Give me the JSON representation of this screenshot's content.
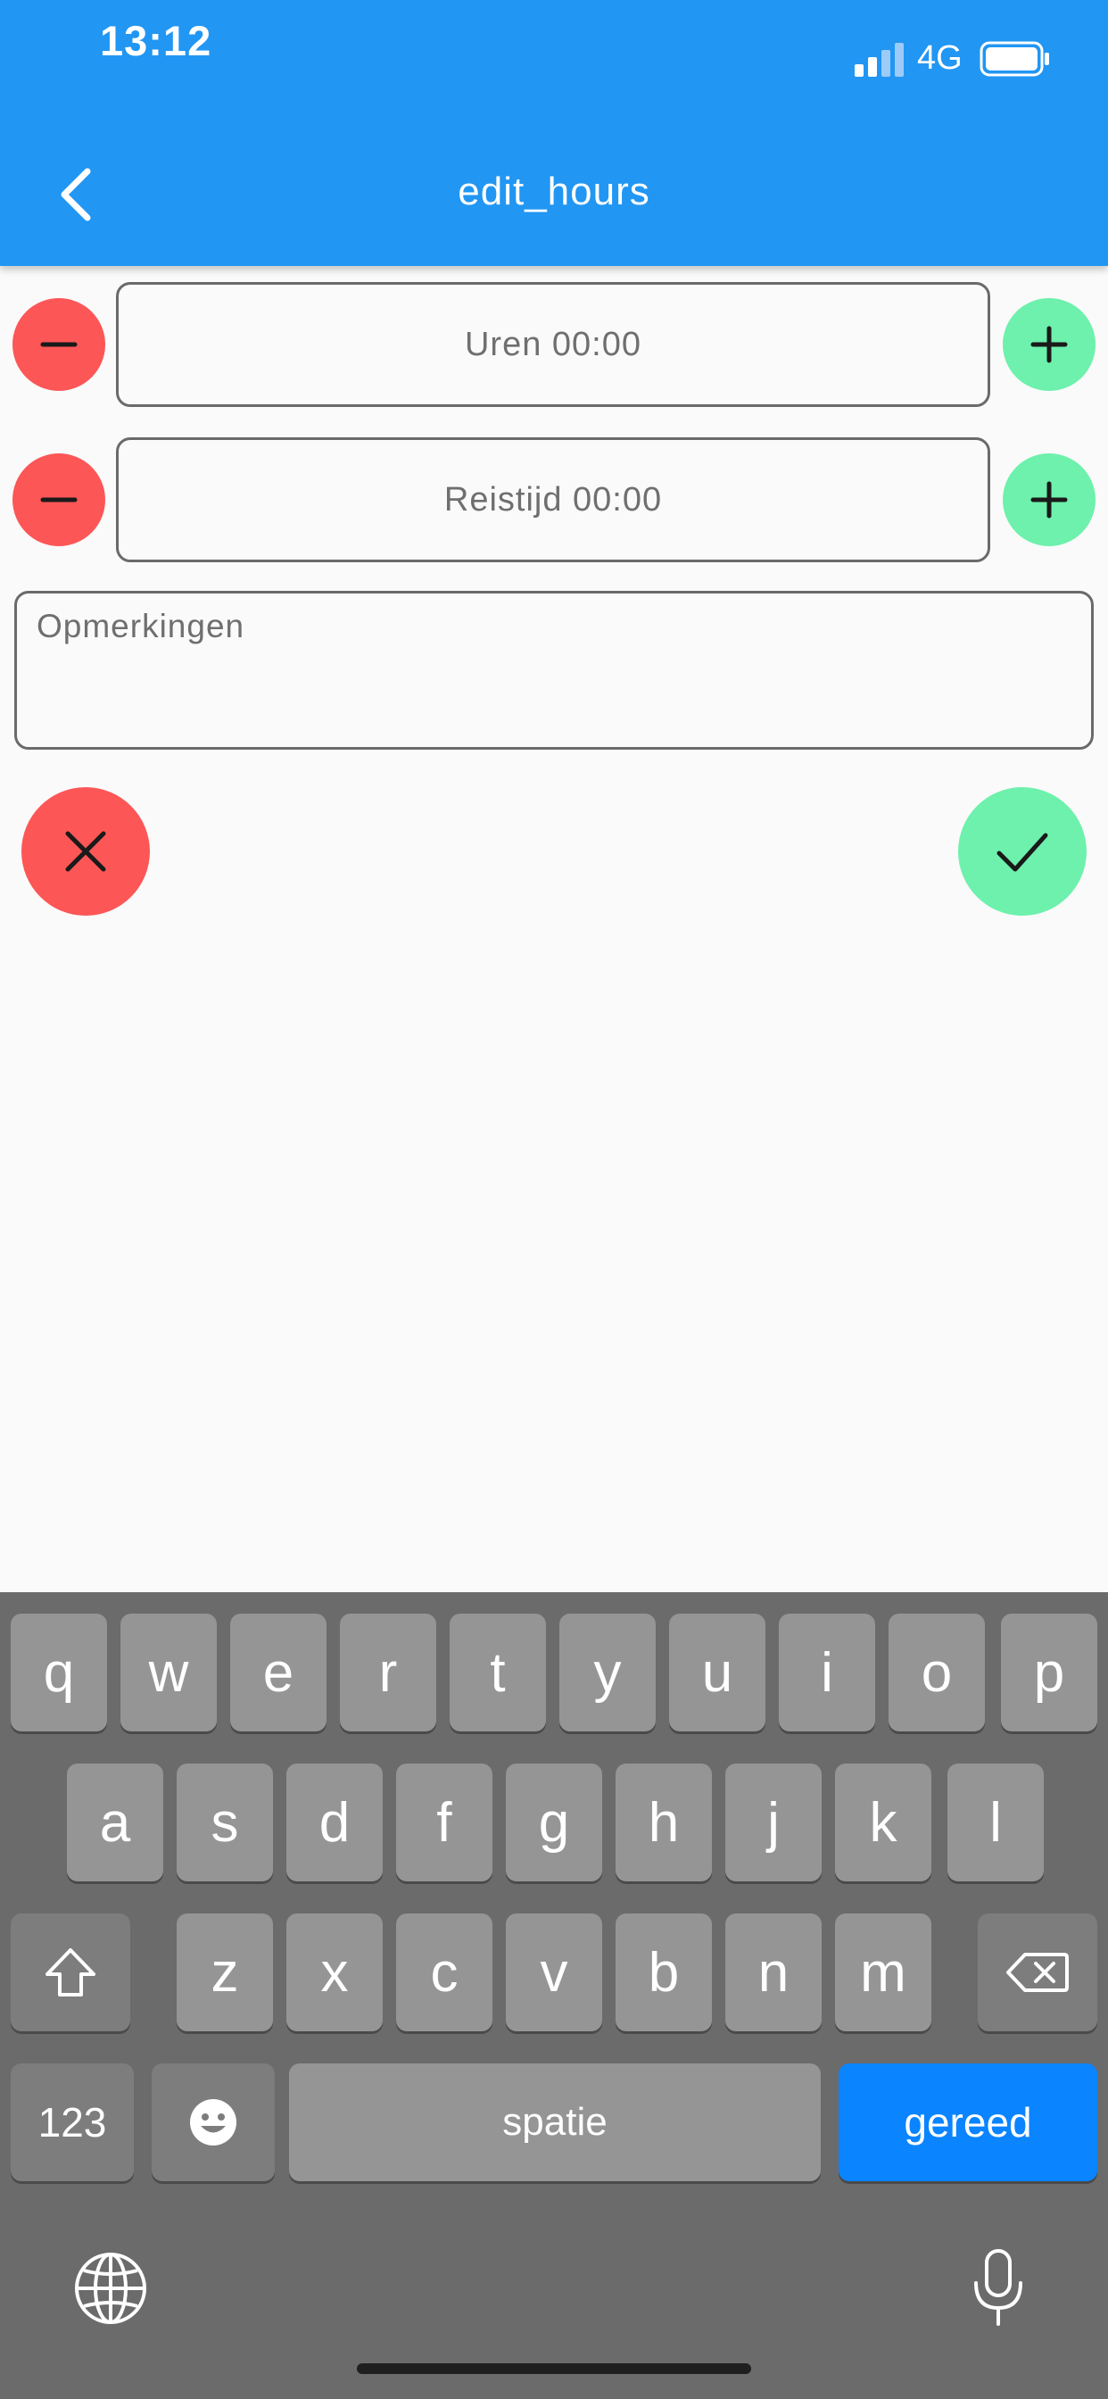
{
  "status_bar": {
    "time": "13:12",
    "network": "4G"
  },
  "app_bar": {
    "title": "edit_hours"
  },
  "form": {
    "hours_field_placeholder": "Uren 00:00",
    "travel_field_placeholder": "Reistijd 00:00",
    "remarks_placeholder": "Opmerkingen"
  },
  "colors": {
    "primary": "#2196f3",
    "decrement": "#fd5656",
    "increment": "#6df1ac",
    "keyboard_done": "#0a84ff"
  },
  "keyboard": {
    "row1": [
      "q",
      "w",
      "e",
      "r",
      "t",
      "y",
      "u",
      "i",
      "o",
      "p"
    ],
    "row2": [
      "a",
      "s",
      "d",
      "f",
      "g",
      "h",
      "j",
      "k",
      "l"
    ],
    "row3": [
      "z",
      "x",
      "c",
      "v",
      "b",
      "n",
      "m"
    ],
    "numbers_label": "123",
    "space_label": "spatie",
    "done_label": "gereed"
  }
}
